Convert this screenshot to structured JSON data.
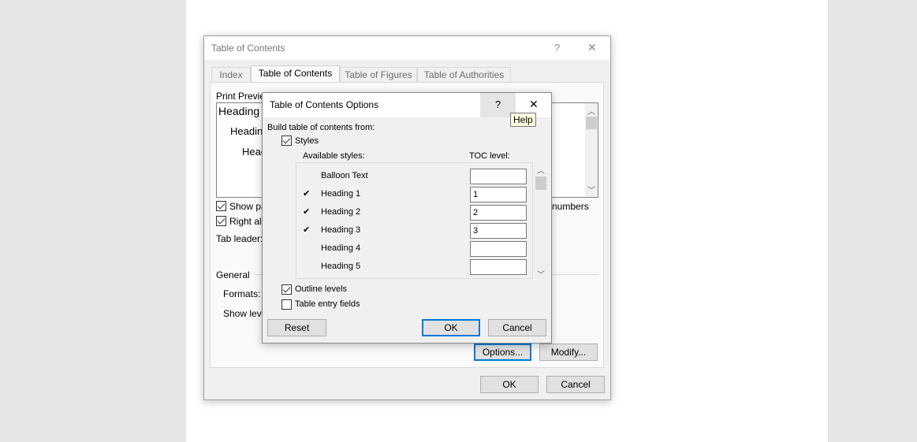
{
  "toc_dialog": {
    "title": "Table of Contents",
    "help": "?",
    "close": "✕",
    "tabs": [
      {
        "label": "Index"
      },
      {
        "label": "Table of Contents",
        "active": true
      },
      {
        "label": "Table of Figures"
      },
      {
        "label": "Table of Authorities"
      }
    ],
    "print_preview_label": "Print Preview",
    "preview": [
      "Heading 1",
      "Heading 2",
      "Heading 3"
    ],
    "show_page_numbers": {
      "label": "Show page numbers",
      "checked": true
    },
    "right_align": {
      "label": "Right align page numbers",
      "checked": true
    },
    "tab_leader_label": "Tab leader:",
    "hyperlinks_fragment": "e numbers",
    "general_label": "General",
    "formats_label": "Formats:",
    "show_levels_label": "Show levels:",
    "options_button": "Options...",
    "modify_button": "Modify...",
    "ok_button": "OK",
    "cancel_button": "Cancel"
  },
  "options_dialog": {
    "title": "Table of Contents Options",
    "help": "?",
    "close": "✕",
    "tooltip": "Help",
    "build_label": "Build table of contents from:",
    "styles": {
      "label": "Styles",
      "checked": true
    },
    "available_styles_label": "Available styles:",
    "toc_level_label": "TOC level:",
    "rows": [
      {
        "check": "",
        "name": "Balloon Text",
        "level": ""
      },
      {
        "check": "✔",
        "name": "Heading 1",
        "level": "1"
      },
      {
        "check": "✔",
        "name": "Heading 2",
        "level": "2"
      },
      {
        "check": "✔",
        "name": "Heading 3",
        "level": "3"
      },
      {
        "check": "",
        "name": "Heading 4",
        "level": ""
      },
      {
        "check": "",
        "name": "Heading 5",
        "level": ""
      }
    ],
    "outline_levels": {
      "label": "Outline levels",
      "checked": true
    },
    "table_entry_fields": {
      "label": "Table entry fields",
      "checked": false
    },
    "reset_button": "Reset",
    "ok_button": "OK",
    "cancel_button": "Cancel"
  }
}
